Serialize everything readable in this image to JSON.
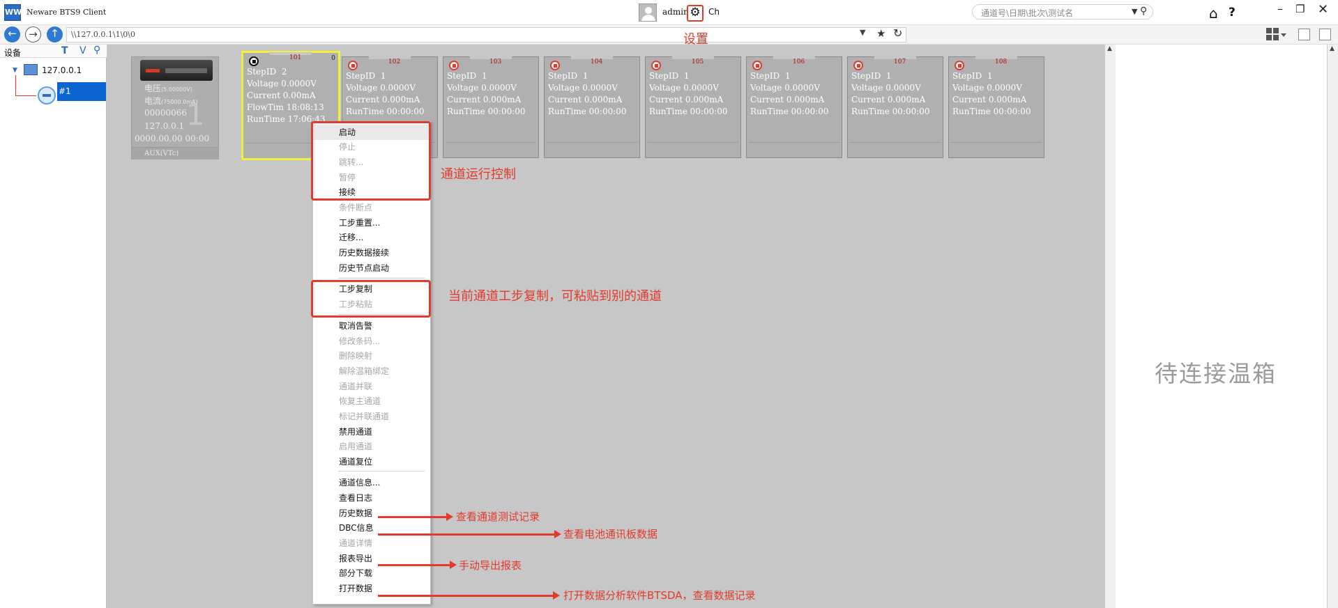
{
  "app": {
    "icon_label": "WW",
    "title": "Neware BTS9 Client",
    "user": "admin",
    "lang": "Ch",
    "search_placeholder": "通道号\\日期\\批次\\测试名"
  },
  "address": {
    "path": "\\\\127.0.0.1\\1\\0\\0"
  },
  "tree": {
    "header": "设备",
    "btn_t": "T",
    "btn_v": "V",
    "server": "127.0.0.1",
    "device": "#1"
  },
  "device": {
    "voltage_label": "电压",
    "voltage_range": "(5.00000V)",
    "current_label": "电流",
    "current_range": "(75000.0mA)",
    "serial": "00000066",
    "ip": "127.0.0.1",
    "time": "0000.00.00 00:00",
    "watermark": "1",
    "aux": "AUX(VTc)"
  },
  "channels": [
    {
      "id": "101",
      "corner": "0",
      "rows": "StepID  2\nVoltage 0.0000V\nCurrent 0.00mA\nFlowTim 18:08:13\nRunTime 17:06:43",
      "status": "running"
    },
    {
      "id": "102",
      "corner": "",
      "rows": "StepID  1\nVoltage 0.0000V\nCurrent 0.000mA\nRunTime 00:00:00",
      "status": "stopped"
    },
    {
      "id": "103",
      "corner": "",
      "rows": "StepID  1\nVoltage 0.0000V\nCurrent 0.000mA\nRunTime 00:00:00",
      "status": "stopped"
    },
    {
      "id": "104",
      "corner": "",
      "rows": "StepID  1\nVoltage 0.0000V\nCurrent 0.000mA\nRunTime 00:00:00",
      "status": "stopped"
    },
    {
      "id": "105",
      "corner": "",
      "rows": "StepID  1\nVoltage 0.0000V\nCurrent 0.000mA\nRunTime 00:00:00",
      "status": "stopped"
    },
    {
      "id": "106",
      "corner": "",
      "rows": "StepID  1\nVoltage 0.0000V\nCurrent 0.000mA\nRunTime 00:00:00",
      "status": "stopped"
    },
    {
      "id": "107",
      "corner": "",
      "rows": "StepID  1\nVoltage 0.0000V\nCurrent 0.000mA\nRunTime 00:00:00",
      "status": "stopped"
    },
    {
      "id": "108",
      "corner": "",
      "rows": "StepID  1\nVoltage 0.0000V\nCurrent 0.000mA\nRunTime 00:00:00",
      "status": "stopped"
    }
  ],
  "menu": [
    {
      "label": "启动",
      "enabled": true
    },
    {
      "label": "停止",
      "enabled": false
    },
    {
      "label": "跳转...",
      "enabled": false
    },
    {
      "label": "暂停",
      "enabled": false
    },
    {
      "label": "接续",
      "enabled": true
    },
    {
      "label": "条件断点",
      "enabled": false
    },
    {
      "label": "工步重置...",
      "enabled": true
    },
    {
      "label": "迁移...",
      "enabled": true
    },
    {
      "label": "历史数据接续",
      "enabled": true
    },
    {
      "label": "历史节点启动",
      "enabled": true
    },
    {
      "label": "工步复制",
      "enabled": true
    },
    {
      "label": "工步粘贴",
      "enabled": false
    },
    {
      "label": "取消告警",
      "enabled": true
    },
    {
      "label": "修改条码...",
      "enabled": false
    },
    {
      "label": "删除映射",
      "enabled": false
    },
    {
      "label": "解除温箱绑定",
      "enabled": false
    },
    {
      "label": "通道并联",
      "enabled": false
    },
    {
      "label": "恢复主通道",
      "enabled": false
    },
    {
      "label": "标记并联通道",
      "enabled": false
    },
    {
      "label": "禁用通道",
      "enabled": true
    },
    {
      "label": "启用通道",
      "enabled": false
    },
    {
      "label": "通道复位",
      "enabled": true
    },
    {
      "label": "通道信息...",
      "enabled": true
    },
    {
      "label": "查看日志",
      "enabled": true
    },
    {
      "label": "历史数据",
      "enabled": true
    },
    {
      "label": "DBC信息",
      "enabled": true
    },
    {
      "label": "通道详情",
      "enabled": false
    },
    {
      "label": "报表导出",
      "enabled": true
    },
    {
      "label": "部分下载",
      "enabled": true
    },
    {
      "label": "打开数据",
      "enabled": true
    }
  ],
  "right_panel": {
    "status": "待连接温箱"
  },
  "annotations": {
    "settings": "设置",
    "run_control": "通道运行控制",
    "copy": "当前通道工步复制，可粘贴到别的通道",
    "history": "查看通道测试记录",
    "dbc": "查看电池通讯板数据",
    "report": "手动导出报表",
    "open_data": "打开数据分析软件BTSDA，查看数据记录"
  },
  "colors": {
    "accent": "#2b6cc4",
    "annotation_red": "#e33a2c",
    "selected_card_border": "#f1ef3a"
  },
  "icons": [
    "app-icon",
    "avatar-icon",
    "gear-icon",
    "search-icon",
    "home-icon",
    "help-icon",
    "back-icon",
    "forward-icon",
    "up-icon",
    "star-icon",
    "refresh-icon",
    "grid-view-icon"
  ]
}
